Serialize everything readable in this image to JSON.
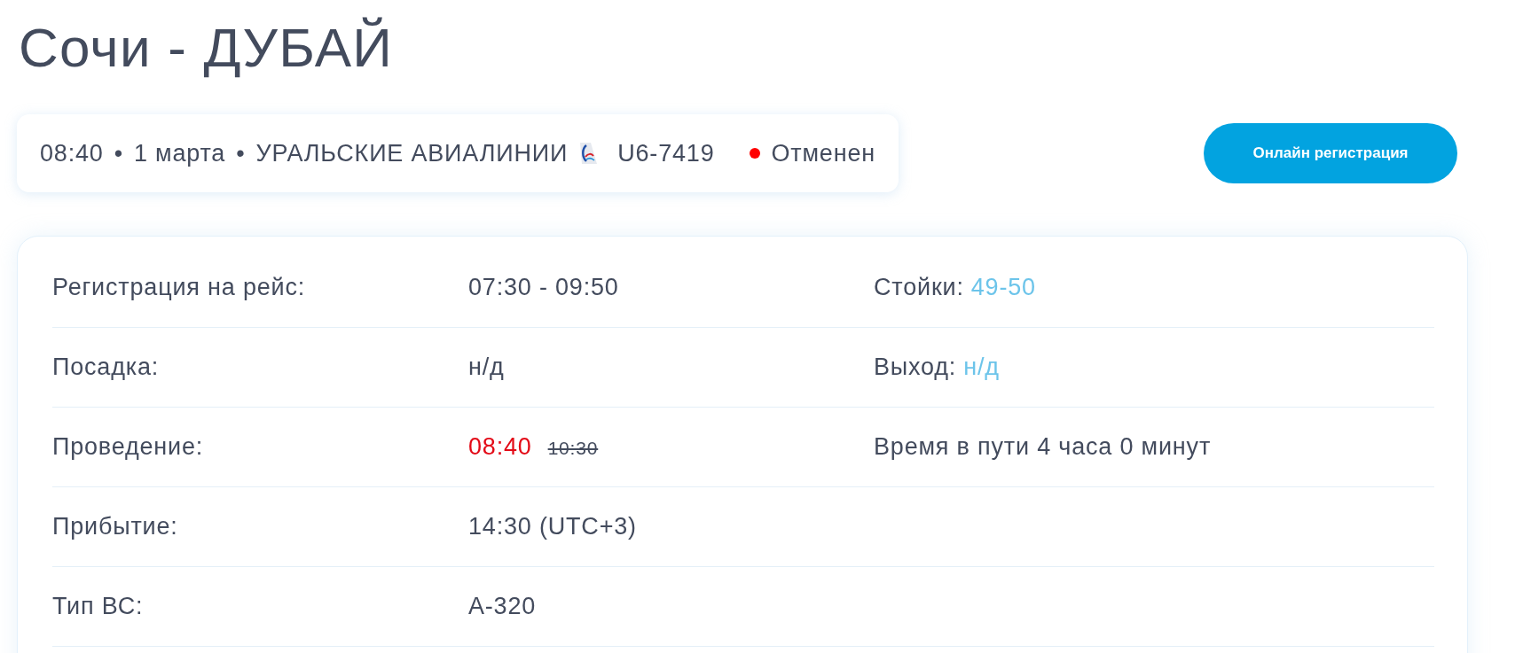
{
  "title": "Сочи - ДУБАЙ",
  "flight": {
    "time": "08:40",
    "sep_1": "•",
    "date": "1 марта",
    "sep_2": "•",
    "airline": "УРАЛЬСКИЕ АВИАЛИНИИ",
    "number": "U6-7419",
    "status": {
      "label": "Отменен",
      "color": "#ff0000"
    }
  },
  "checkin_button": "Онлайн регистрация",
  "details": [
    {
      "label": "Регистрация на рейс:",
      "value": {
        "kind": "plain",
        "text": "07:30 - 09:50"
      },
      "extra": {
        "kind": "pair",
        "label": "Стойки:",
        "value": "49-50"
      }
    },
    {
      "label": "Посадка:",
      "value": {
        "kind": "plain",
        "text": "н/д"
      },
      "extra": {
        "kind": "pair",
        "label": "Выход:",
        "value": "н/д"
      }
    },
    {
      "label": "Проведение:",
      "value": {
        "kind": "changed",
        "actual": "08:40",
        "scheduled": "10:30"
      },
      "extra": {
        "kind": "text",
        "text": "Время в пути 4 часа 0 минут"
      }
    },
    {
      "label": "Прибытие:",
      "value": {
        "kind": "plain",
        "text": "14:30 (UTC+3)"
      }
    },
    {
      "label": "Тип ВС:",
      "value": {
        "kind": "plain",
        "text": "A-320"
      }
    }
  ]
}
